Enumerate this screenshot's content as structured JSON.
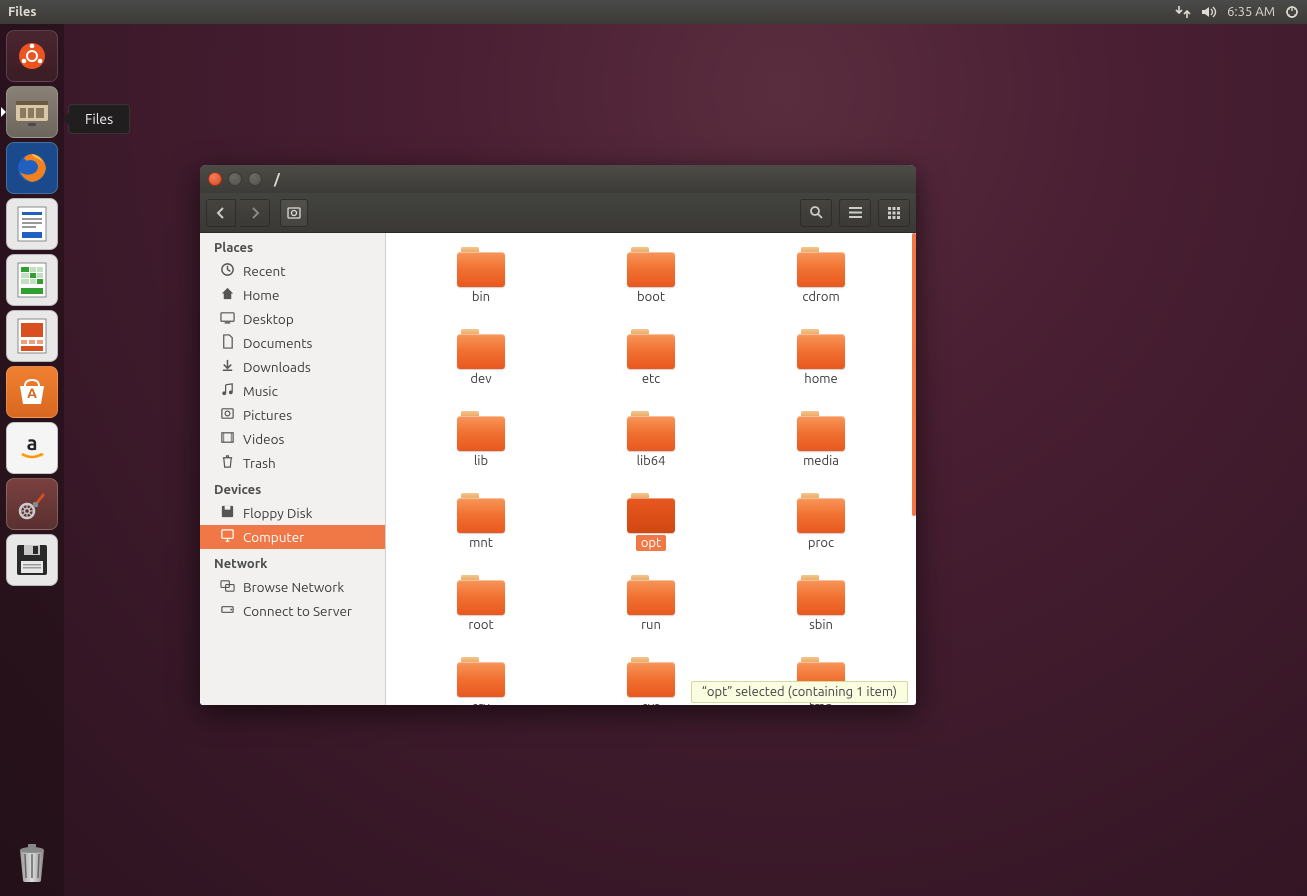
{
  "menubar": {
    "app": "Files",
    "time": "6:35 AM"
  },
  "launcher": {
    "tooltip": "Files",
    "items": [
      "dash",
      "files",
      "firefox",
      "writer",
      "calc",
      "impress",
      "software",
      "amazon",
      "settings",
      "floppy"
    ]
  },
  "window": {
    "title": "/",
    "sidebar": {
      "sections": {
        "places": "Places",
        "devices": "Devices",
        "network": "Network"
      },
      "places": [
        {
          "id": "recent",
          "label": "Recent"
        },
        {
          "id": "home",
          "label": "Home"
        },
        {
          "id": "desktop",
          "label": "Desktop"
        },
        {
          "id": "documents",
          "label": "Documents"
        },
        {
          "id": "downloads",
          "label": "Downloads"
        },
        {
          "id": "music",
          "label": "Music"
        },
        {
          "id": "pictures",
          "label": "Pictures"
        },
        {
          "id": "videos",
          "label": "Videos"
        },
        {
          "id": "trash",
          "label": "Trash"
        }
      ],
      "devices": [
        {
          "id": "floppy",
          "label": "Floppy Disk"
        },
        {
          "id": "computer",
          "label": "Computer",
          "active": true
        }
      ],
      "network": [
        {
          "id": "browse",
          "label": "Browse Network"
        },
        {
          "id": "connect",
          "label": "Connect to Server"
        }
      ]
    },
    "folders": [
      {
        "name": "bin"
      },
      {
        "name": "boot"
      },
      {
        "name": "cdrom"
      },
      {
        "name": "dev"
      },
      {
        "name": "etc"
      },
      {
        "name": "home"
      },
      {
        "name": "lib"
      },
      {
        "name": "lib64"
      },
      {
        "name": "media"
      },
      {
        "name": "mnt"
      },
      {
        "name": "opt",
        "selected": true
      },
      {
        "name": "proc"
      },
      {
        "name": "root"
      },
      {
        "name": "run"
      },
      {
        "name": "sbin"
      },
      {
        "name": "srv"
      },
      {
        "name": "sys"
      },
      {
        "name": "tmp"
      }
    ],
    "status": "“opt” selected  (containing 1 item)"
  }
}
